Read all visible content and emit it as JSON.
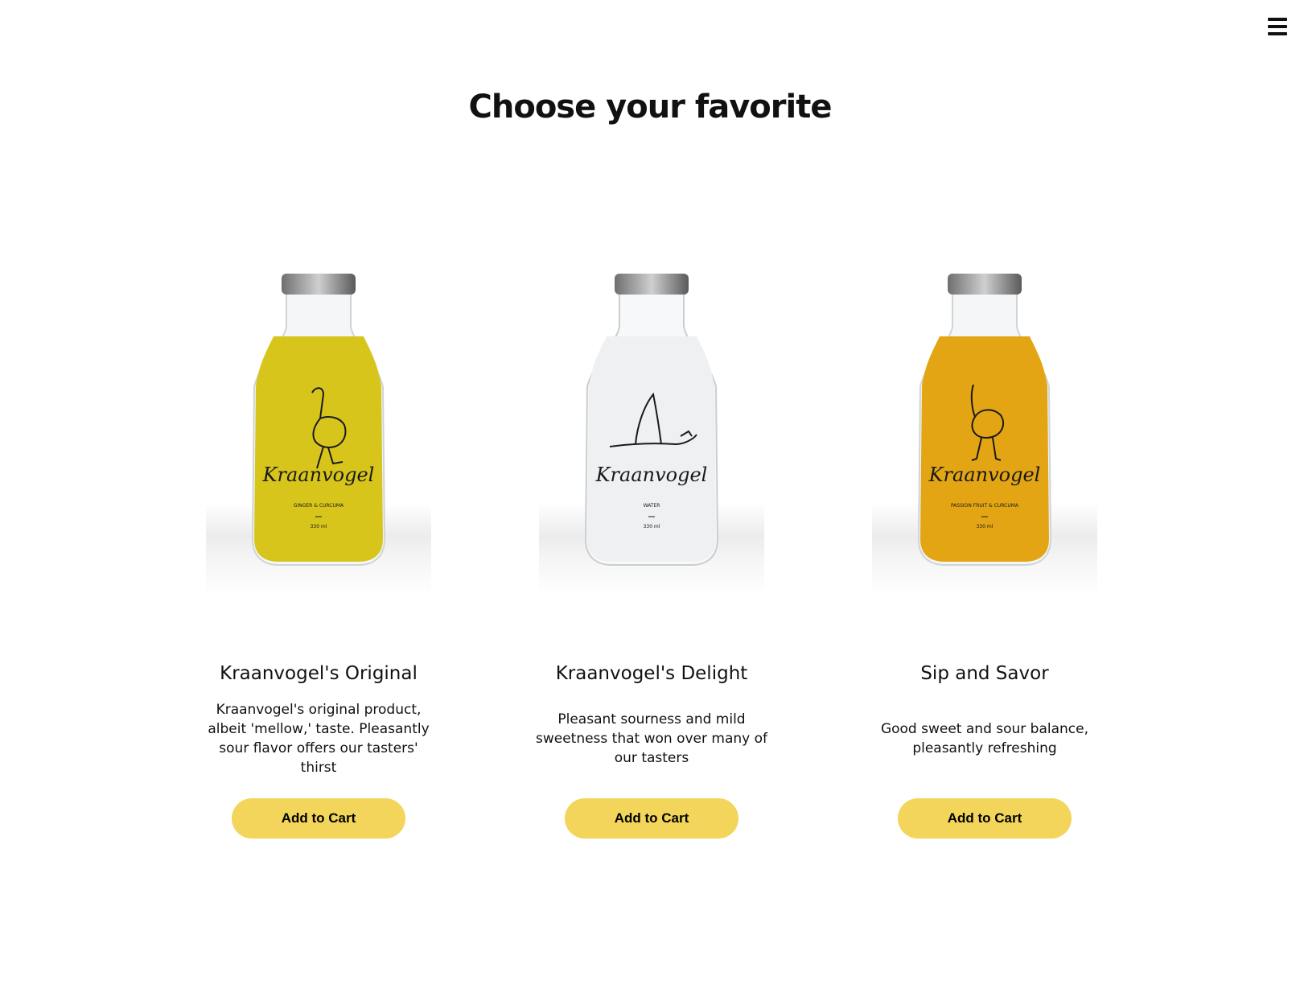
{
  "header": {
    "menu_icon": "hamburger-menu-icon"
  },
  "section": {
    "heading": "Choose your favorite"
  },
  "products": [
    {
      "name": "Kraanvogel's Original",
      "description": "Kraanvogel's original product, albeit 'mellow,' taste. Pleasantly sour flavor offers our tasters' thirst",
      "cta": "Add to Cart",
      "image": {
        "brand": "Kraanvogel",
        "flavor": "GINGER & CURCUMA",
        "volume": "330 ml",
        "liquid_color": "#d8c51c",
        "icon": "crane-bottle-image"
      }
    },
    {
      "name": "Kraanvogel's Delight",
      "description": "Pleasant sourness and mild sweetness that won over many of our tasters",
      "cta": "Add to Cart",
      "image": {
        "brand": "Kraanvogel",
        "flavor": "WATER",
        "volume": "330 ml",
        "liquid_color": "#f1f3f4",
        "icon": "crane-bottle-image"
      }
    },
    {
      "name": "Sip and Savor",
      "description": "Good sweet and sour balance, pleasantly refreshing",
      "cta": "Add to Cart",
      "image": {
        "brand": "Kraanvogel",
        "flavor": "PASSION FRUIT & CURCUMA",
        "volume": "330 ml",
        "liquid_color": "#e3a514",
        "icon": "ostrich-bottle-image"
      }
    }
  ],
  "colors": {
    "button": "#f2d55a",
    "text": "#111111",
    "background": "#ffffff"
  }
}
